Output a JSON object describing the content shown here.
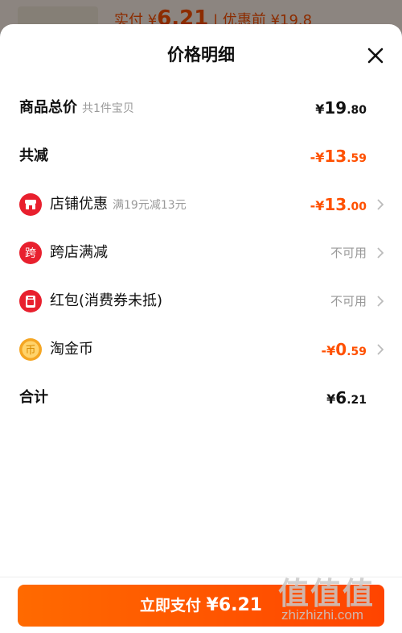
{
  "background_peek": {
    "text_prefix": "实付 ¥",
    "text_amount": "6.21",
    "text_suffix": " | 优惠前 ¥19.8"
  },
  "sheet": {
    "title": "价格明细"
  },
  "rows": {
    "goods_total": {
      "label": "商品总价",
      "sub": "共1件宝贝",
      "yen": "¥",
      "int": "19",
      "dec": ".80"
    },
    "total_reduce": {
      "label": "共减",
      "yen": "-¥",
      "int": "13",
      "dec": ".59"
    },
    "shop_discount": {
      "label": "店铺优惠",
      "sub": "满19元减13元",
      "yen": "-¥",
      "int": "13",
      "dec": ".00",
      "icon": "shop-icon"
    },
    "cross_store": {
      "label": "跨店满减",
      "status": "不可用",
      "icon": "cross-store-icon",
      "icon_text": "跨"
    },
    "red_packet": {
      "label": "红包(消费券未抵)",
      "status": "不可用",
      "icon": "red-packet-icon"
    },
    "taojinbi": {
      "label": "淘金币",
      "yen": "-¥",
      "int": "0",
      "dec": ".59",
      "icon": "coin-icon",
      "icon_text": "币"
    },
    "sum": {
      "label": "合计",
      "yen": "¥",
      "int": "6",
      "dec": ".21"
    }
  },
  "pay_button": {
    "label": "立即支付",
    "amount": "¥6.21"
  },
  "watermark": {
    "chars": "值值值",
    "url": "zhizhizhi.com"
  },
  "colors": {
    "accent": "#ff5000",
    "muted": "#999999",
    "icon_red": "#e8202e",
    "coin": "#f5a623"
  }
}
